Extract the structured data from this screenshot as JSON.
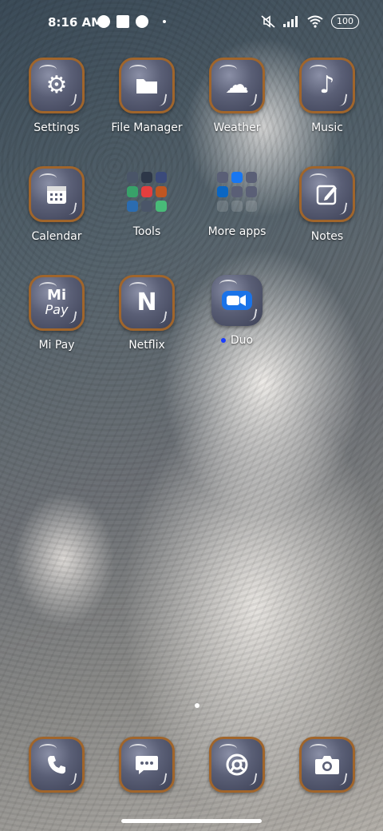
{
  "status_bar": {
    "time": "8:16 AM",
    "battery": "100"
  },
  "apps": [
    {
      "label": "Settings",
      "icon": "gear-icon",
      "glyph": "⚙"
    },
    {
      "label": "File Manager",
      "icon": "folder-icon",
      "glyph": "▬"
    },
    {
      "label": "Weather",
      "icon": "cloud-icon",
      "glyph": "☁"
    },
    {
      "label": "Music",
      "icon": "music-note-icon",
      "glyph": "♪"
    },
    {
      "label": "Calendar",
      "icon": "calendar-icon",
      "glyph": "▦"
    },
    {
      "label": "Tools",
      "icon": "folder-tools-icon",
      "glyph": ""
    },
    {
      "label": "More apps",
      "icon": "folder-more-apps-icon",
      "glyph": ""
    },
    {
      "label": "Notes",
      "icon": "pencil-note-icon",
      "glyph": "✎"
    },
    {
      "label": "Mi Pay",
      "icon": "mi-pay-icon",
      "glyph": "Mi"
    },
    {
      "label": "Netflix",
      "icon": "netflix-icon",
      "glyph": "N"
    },
    {
      "label": "Duo",
      "icon": "duo-video-icon",
      "glyph": "■"
    }
  ],
  "mi_pay_sub": "Pay",
  "dock": [
    {
      "icon": "phone-icon",
      "glyph": "✆"
    },
    {
      "icon": "messages-icon",
      "glyph": "…"
    },
    {
      "icon": "chrome-icon",
      "glyph": "◎"
    },
    {
      "icon": "camera-icon",
      "glyph": "◙"
    }
  ]
}
